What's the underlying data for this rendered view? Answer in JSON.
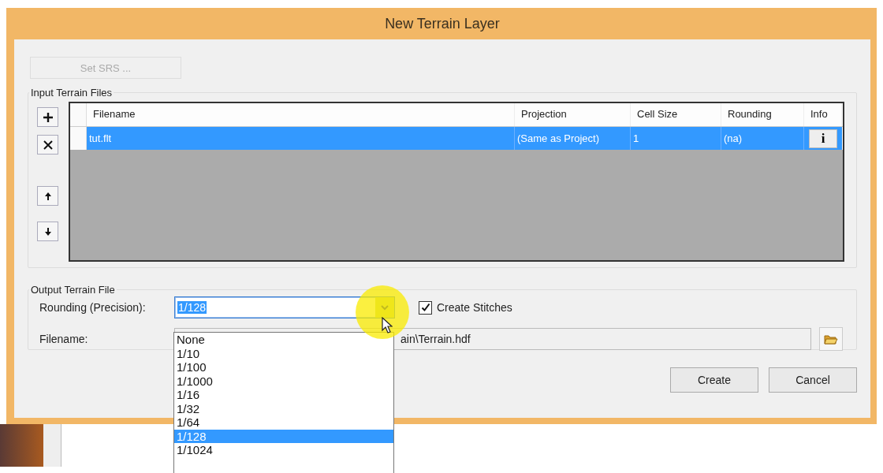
{
  "window": {
    "title": "New Terrain Layer"
  },
  "set_srs_button": {
    "label": "Set SRS ...",
    "disabled": true
  },
  "input_group": {
    "title": "Input Terrain Files",
    "side_buttons": [
      {
        "kind": "add"
      },
      {
        "kind": "remove"
      },
      {
        "kind": "up"
      },
      {
        "kind": "down"
      }
    ],
    "table": {
      "columns": [
        "Filename",
        "Projection",
        "Cell Size",
        "Rounding",
        "Info"
      ],
      "rows": [
        {
          "selected": true,
          "cells": [
            "tut.flt",
            "(Same as Project)",
            "1",
            "(na)"
          ],
          "info": "i"
        }
      ]
    }
  },
  "output_group": {
    "title": "Output Terrain File",
    "rounding": {
      "label": "Rounding (Precision):",
      "value": "1/128",
      "expanded": true,
      "options": [
        {
          "label": "None",
          "selected": false
        },
        {
          "label": "1/10",
          "selected": false
        },
        {
          "label": "1/100",
          "selected": false
        },
        {
          "label": "1/1000",
          "selected": false
        },
        {
          "label": "1/16",
          "selected": false
        },
        {
          "label": "1/32",
          "selected": false
        },
        {
          "label": "1/64",
          "selected": false
        },
        {
          "label": "1/128",
          "selected": true
        },
        {
          "label": "1/1024",
          "selected": false
        }
      ]
    },
    "create_stitches": {
      "label": "Create Stitches",
      "checked": true
    },
    "filename": {
      "label": "Filename:",
      "value": "ain\\Terrain.hdf"
    }
  },
  "buttons": [
    "Create",
    "Cancel"
  ]
}
